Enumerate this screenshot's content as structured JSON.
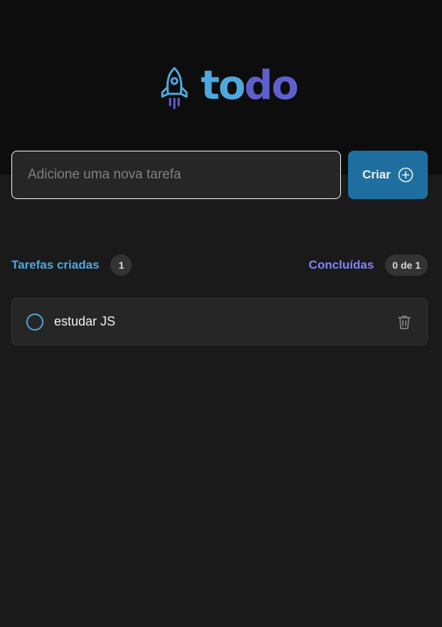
{
  "app": {
    "logo_text_part1": "to",
    "logo_text_part2": "do",
    "logo_icon": "rocket-icon"
  },
  "form": {
    "placeholder": "Adicione uma nova tarefa",
    "value": "",
    "create_label": "Criar",
    "create_icon": "plus-circle-icon"
  },
  "counters": {
    "created_label": "Tarefas criadas",
    "created_count": "1",
    "done_label": "Concluídas",
    "done_count": "0 de 1"
  },
  "tasks": [
    {
      "text": "estudar JS",
      "completed": false
    }
  ],
  "colors": {
    "header_bg": "#0d0d0d",
    "page_bg": "#1a1a1a",
    "blue": "#4ea8de",
    "blue_dark": "#1e6f9f",
    "purple": "#5e60ce",
    "purple_light": "#8284fa"
  }
}
